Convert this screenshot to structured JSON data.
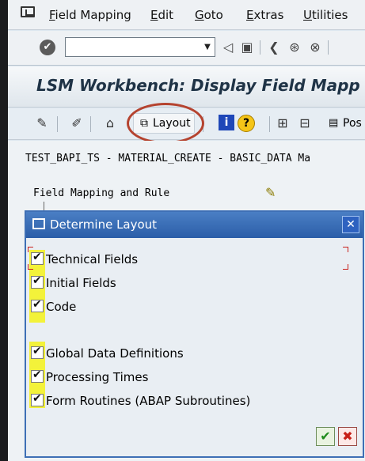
{
  "menu": {
    "items": [
      "Field Mapping",
      "Edit",
      "Goto",
      "Extras",
      "Utilities"
    ]
  },
  "toolbar": {
    "command_field_value": ""
  },
  "title": "LSM Workbench: Display Field Mapp",
  "app_toolbar": {
    "layout_label": "Layout",
    "pos_label": "Pos"
  },
  "content": {
    "line1": "TEST_BAPI_TS - MATERIAL_CREATE - BASIC_DATA Ma",
    "line2": "Field Mapping and Rule"
  },
  "dialog": {
    "title": "Determine Layout",
    "options": [
      {
        "label": "Technical Fields",
        "checked": true
      },
      {
        "label": "Initial Fields",
        "checked": true
      },
      {
        "label": "Code",
        "checked": true
      },
      {
        "label": "Global Data Definitions",
        "checked": true
      },
      {
        "label": "Processing Times",
        "checked": true
      },
      {
        "label": "Form Routines (ABAP Subroutines)",
        "checked": true
      }
    ]
  },
  "colors": {
    "highlight": "#f3f23a",
    "annotation_ring": "#b5432f",
    "dialog_title": "#2b5ea8"
  }
}
